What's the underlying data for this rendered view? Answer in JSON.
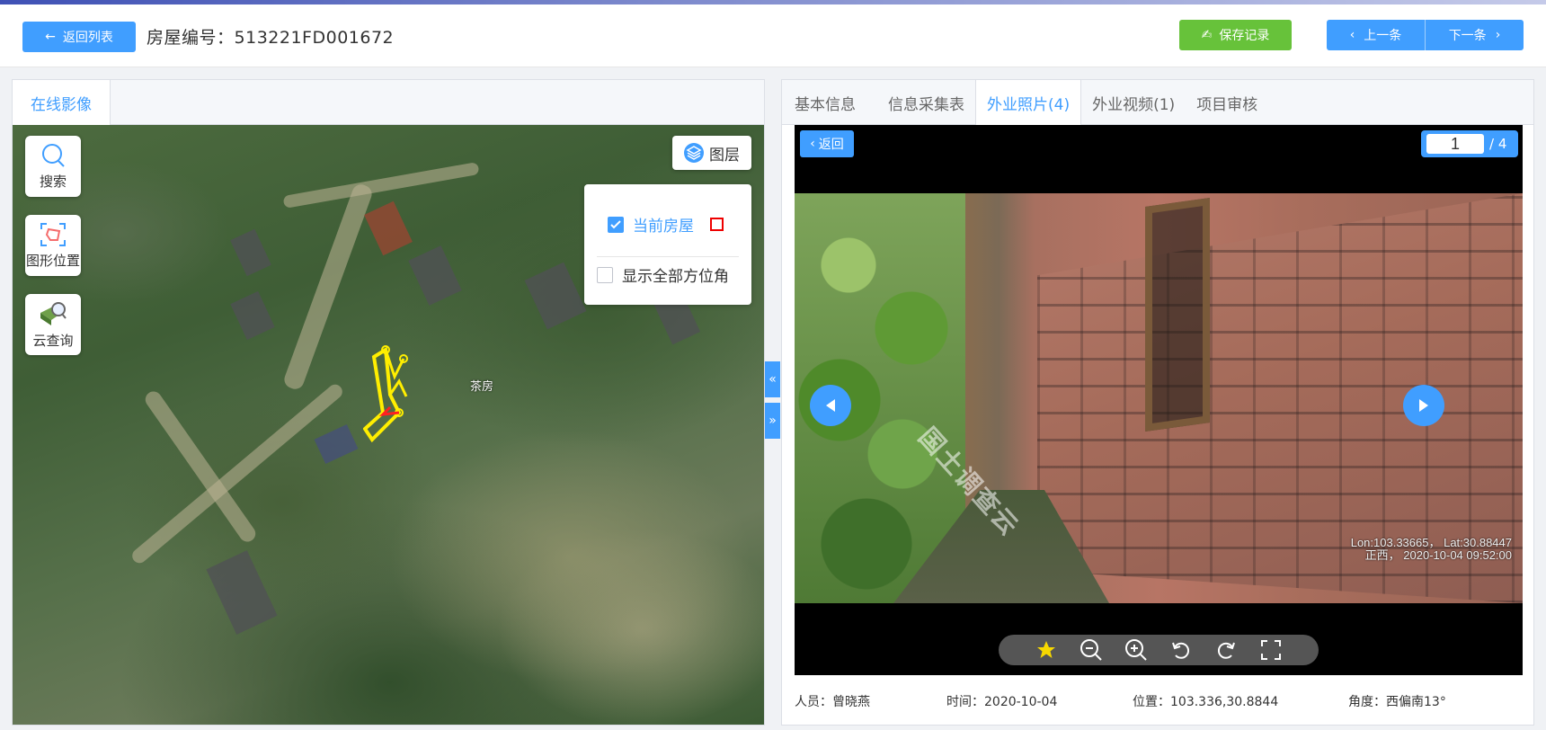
{
  "header": {
    "back_label": "返回列表",
    "house_no_label": "房屋编号：",
    "house_no_value": "513221FD001672",
    "save_label": "保存记录",
    "prev_label": "上一条",
    "next_label": "下一条"
  },
  "left": {
    "tab_label": "在线影像",
    "tools": {
      "search": "搜索",
      "shape_position": "图形位置",
      "cloud_query": "云查询"
    },
    "layer_button": "图层",
    "layers": {
      "current_house": "当前房屋",
      "show_all_azimuths": "显示全部方位角"
    },
    "place_name": "茶房"
  },
  "right": {
    "tabs": [
      "基本信息",
      "信息采集表",
      "外业照片(4)",
      "外业视频(1)",
      "项目审核"
    ],
    "viewer": {
      "back_label": "返回",
      "current_page": "1",
      "total_label": "/ 4",
      "watermark": "国土调查云",
      "coords": "Lon:103.33665， Lat:30.88447",
      "direction_time": "正西，  2020-10-04 09:52:00"
    },
    "info": {
      "person": "人员：曾晓燕",
      "time": "时间：2020-10-04",
      "location": "位置：103.336,30.8844",
      "angle": "角度：西偏南13°"
    }
  },
  "colors": {
    "primary": "#409eff",
    "success": "#67c23a"
  }
}
